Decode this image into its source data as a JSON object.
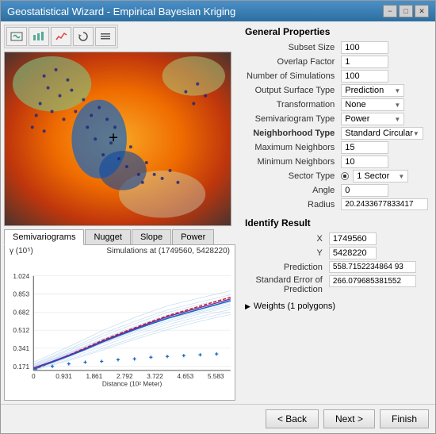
{
  "window": {
    "title": "Geostatistical Wizard  -  Empirical Bayesian Kriging",
    "minimize_label": "−",
    "maximize_label": "□",
    "close_label": "✕"
  },
  "toolbar": {
    "buttons": [
      "🗺",
      "📊",
      "📈",
      "🔄",
      "⚙"
    ]
  },
  "tabs": {
    "items": [
      {
        "label": "Semivariograms",
        "active": true
      },
      {
        "label": "Nugget",
        "active": false
      },
      {
        "label": "Slope",
        "active": false
      },
      {
        "label": "Power",
        "active": false
      }
    ]
  },
  "chart": {
    "title": "Simulations at (1749560, 5428220)",
    "y_label": "γ (10⁵)",
    "x_label": "Distance (10² Meter)",
    "y_values": [
      "1.024",
      "0.853",
      "0.682",
      "0.512",
      "0.341",
      "0.171"
    ],
    "x_values": [
      "0",
      "0.931",
      "1.861",
      "2.792",
      "3.722",
      "4.653",
      "5.583"
    ]
  },
  "properties": {
    "section_title": "General Properties",
    "rows": [
      {
        "label": "Subset Size",
        "value": "100",
        "type": "input"
      },
      {
        "label": "Overlap Factor",
        "value": "1",
        "type": "input"
      },
      {
        "label": "Number of Simulations",
        "value": "100",
        "type": "input"
      },
      {
        "label": "Output Surface Type",
        "value": "Prediction",
        "type": "select"
      },
      {
        "label": "Transformation",
        "value": "None",
        "type": "select"
      },
      {
        "label": "Semivariogram Type",
        "value": "Power",
        "type": "select"
      }
    ],
    "neighborhood_type": {
      "label": "Neighborhood Type",
      "value": "Standard Circular",
      "type": "select"
    },
    "neighborhood_rows": [
      {
        "label": "Maximum Neighbors",
        "value": "15",
        "type": "input"
      },
      {
        "label": "Minimum Neighbors",
        "value": "10",
        "type": "input"
      },
      {
        "label": "Sector Type",
        "value": "1 Sector",
        "type": "radio_select"
      },
      {
        "label": "Angle",
        "value": "0",
        "type": "input"
      },
      {
        "label": "Radius",
        "value": "20.2433677833417",
        "type": "input"
      }
    ]
  },
  "identify": {
    "section_title": "Identify Result",
    "rows": [
      {
        "label": "X",
        "value": "1749560"
      },
      {
        "label": "Y",
        "value": "5428220"
      },
      {
        "label": "Prediction",
        "value": "558.7152234864 93"
      },
      {
        "label": "Standard Error of Prediction",
        "value": "266.079685381552"
      }
    ],
    "weights_label": "Weights (1 polygons)"
  },
  "buttons": {
    "back": "< Back",
    "next": "Next >",
    "finish": "Finish"
  }
}
